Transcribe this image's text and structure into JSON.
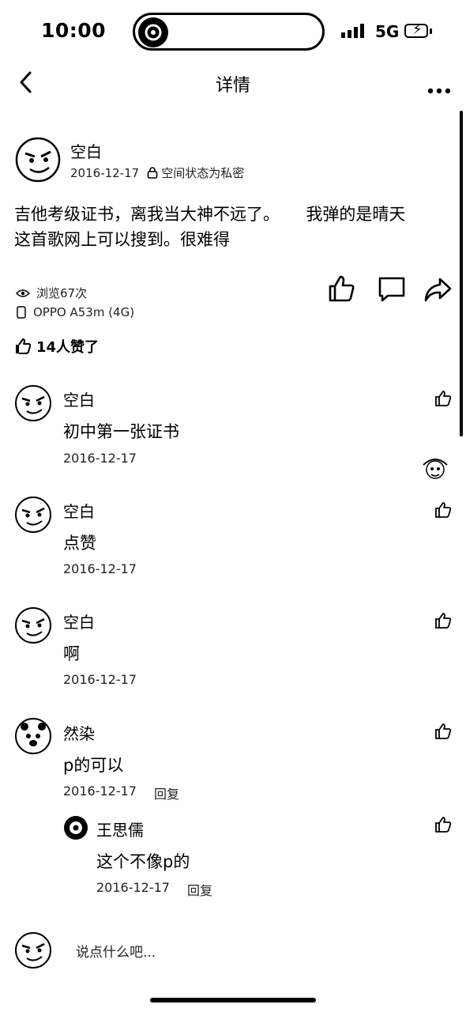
{
  "status": {
    "time": "10:00",
    "network": "5G"
  },
  "nav": {
    "title": "详情"
  },
  "post": {
    "author": "空白",
    "date": "2016-12-17",
    "privacy": "空间状态为私密",
    "content": "吉他考级证书，离我当大神不远了。     我弹的是晴天\n这首歌网上可以搜到。很难得",
    "views": "浏览67次",
    "device": "OPPO A53m (4G)",
    "likes": "14人赞了"
  },
  "comments": [
    {
      "name": "空白",
      "text": "初中第一张证书",
      "date": "2016-12-17"
    },
    {
      "name": "空白",
      "text": "点赞",
      "date": "2016-12-17"
    },
    {
      "name": "空白",
      "text": "啊",
      "date": "2016-12-17"
    },
    {
      "name": "然染",
      "text": "p的可以",
      "date": "2016-12-17",
      "reply_label": "回复"
    }
  ],
  "reply": {
    "name": "王思儒",
    "text": "这个不像p的",
    "date": "2016-12-17",
    "reply_label": "回复"
  },
  "composer": {
    "placeholder": "说点什么吧..."
  },
  "icons": {
    "back": "chevron-left-icon",
    "more": "more-icon",
    "like": "thumbs-up-icon",
    "comment": "comment-icon",
    "share": "share-icon",
    "eye": "eye-icon",
    "phone": "phone-icon",
    "lock": "lock-icon"
  }
}
